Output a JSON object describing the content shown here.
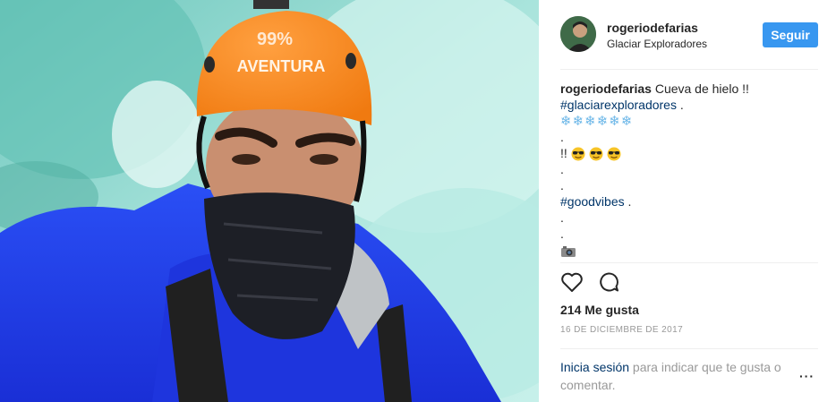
{
  "post": {
    "username": "rogeriodefarias",
    "location": "Glaciar Exploradores",
    "follow_label": "Seguir",
    "caption": {
      "username": "rogeriodefarias",
      "text": "Cueva de hielo !!",
      "hashtag1": "#glaciarexploradores",
      "hashtag1_suffix": " .",
      "snowflakes": "❄❄❄❄❄❄",
      "dot": ".",
      "exclaim": "!!",
      "hashtag2": "#goodvibes",
      "hashtag2_suffix": " ."
    },
    "likes": "214 Me gusta",
    "date": "16 DE DICIEMBRE DE 2017",
    "login_link": "Inicia sesión",
    "login_rest": " para indicar que te gusta o comentar.",
    "more_label": "···"
  },
  "helmet": {
    "line1": "99%",
    "line2": "AVENTURA"
  },
  "icons": {
    "like": "heart-icon",
    "comment": "comment-bubble-icon",
    "sunglasses": "sunglasses-emoji-icon",
    "camera": "camera-emoji-icon",
    "options": "more-options-icon"
  },
  "colors": {
    "accent": "#3897f0",
    "hashtag": "#003569",
    "muted": "#999999",
    "text": "#262626"
  }
}
